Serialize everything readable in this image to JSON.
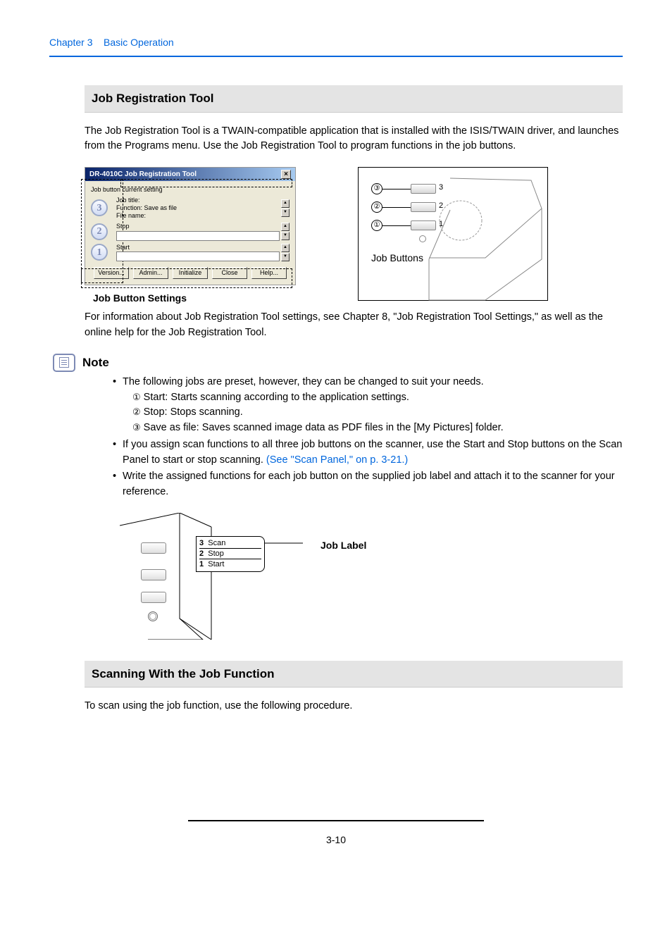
{
  "header": {
    "chapter": "Chapter 3",
    "title": "Basic Operation"
  },
  "section1": {
    "heading": "Job Registration Tool",
    "intro": "The Job Registration Tool is a TWAIN-compatible application that is installed with the ISIS/TWAIN driver, and launches from the Programs menu. Use the Job Registration Tool to program functions in the job buttons.",
    "dialog": {
      "title": "DR-4010C Job Registration Tool",
      "group_label": "Job button current setting",
      "rows": [
        {
          "num": "3",
          "lines": [
            "Job title:",
            "Function: Save as file",
            "File name:"
          ]
        },
        {
          "num": "2",
          "lines": [
            "Stop"
          ]
        },
        {
          "num": "1",
          "lines": [
            "Start"
          ]
        }
      ],
      "buttons": [
        "Version...",
        "Admin...",
        "Initialize",
        "Close",
        "Help..."
      ],
      "caption": "Job Button Settings"
    },
    "scanner_fig": {
      "label": "Job Buttons"
    },
    "after_fig": "For information about Job Registration Tool settings, see Chapter 8, \"Job Registration Tool Settings,\" as well as the online help for the Job Registration Tool."
  },
  "note": {
    "heading": "Note",
    "bullet1_intro": "The following jobs are preset, however, they can be changed to suit your needs.",
    "sub1": " Start: Starts scanning according to the application settings.",
    "sub2": " Stop: Stops scanning.",
    "sub3": " Save as file: Saves scanned image data as PDF files in the [My Pictures] folder.",
    "bullet2_a": "If you assign scan functions to all three job buttons on the scanner, use the Start and Stop buttons on the Scan Panel to start or stop scanning. ",
    "bullet2_link": "(See \"Scan Panel,\" on p. 3-21.)",
    "bullet3": "Write the assigned functions for each job button on the supplied job label and attach it to the scanner for your reference.",
    "circled": {
      "c1": "①",
      "c2": "②",
      "c3": "③"
    }
  },
  "job_label_fig": {
    "lines": [
      "3  Scan",
      "2  Stop",
      "1  Start"
    ],
    "caption": "Job Label"
  },
  "section2": {
    "heading": "Scanning With the Job Function",
    "intro": "To scan using the job function, use the following procedure."
  },
  "page_number": "3-10"
}
